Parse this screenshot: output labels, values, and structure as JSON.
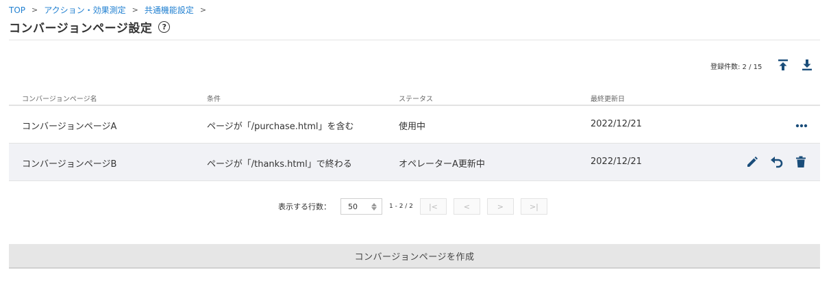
{
  "breadcrumb": {
    "items": [
      "TOP",
      "アクション・効果測定",
      "共通機能設定"
    ],
    "separator": ">"
  },
  "page": {
    "title": "コンバージョンページ設定",
    "help_glyph": "?"
  },
  "toolbar": {
    "count_text": "登録件数: 2 / 15"
  },
  "table": {
    "headers": [
      "コンバージョンページ名",
      "条件",
      "ステータス",
      "最終更新日"
    ],
    "rows": [
      {
        "name": "コンバージョンページA",
        "condition": "ページが「/purchase.html」を含む",
        "status": "使用中",
        "updated": "2022/12/21"
      },
      {
        "name": "コンバージョンページB",
        "condition": "ページが「/thanks.html」で終わる",
        "status": "オペレーターA更新中",
        "updated": "2022/12/21"
      }
    ]
  },
  "pager": {
    "label": "表示する行数：",
    "rows_per_page": "50",
    "range": "1 - 2 / 2",
    "first": "|<",
    "prev": "<",
    "next": ">",
    "last": ">|"
  },
  "actions": {
    "create_label": "コンバージョンページを作成"
  },
  "colors": {
    "link": "#1f7fd0",
    "icon": "#1a4d7a",
    "row_alt": "#f1f2f6"
  }
}
